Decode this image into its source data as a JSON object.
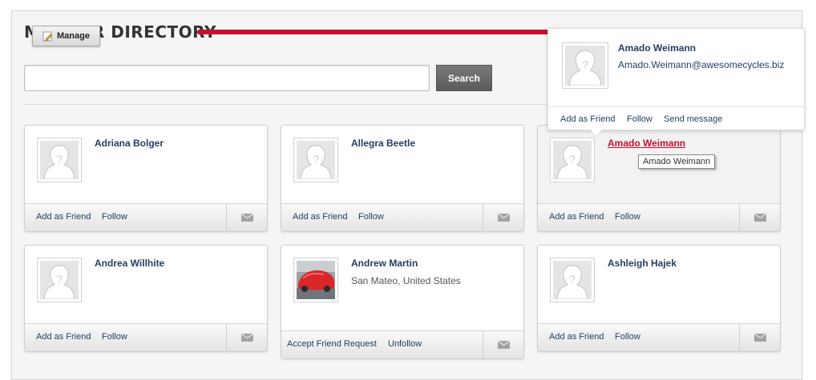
{
  "header": {
    "title": "MEMBER DIRECTORY",
    "manage_label": "Manage"
  },
  "search": {
    "value": "",
    "placeholder": "",
    "button_label": "Search"
  },
  "members": [
    {
      "name": "Adriana Bolger",
      "location": "",
      "actions": [
        "Add as Friend",
        "Follow"
      ]
    },
    {
      "name": "Allegra Beetle",
      "location": "",
      "actions": [
        "Add as Friend",
        "Follow"
      ]
    },
    {
      "name": "Amado Weimann",
      "location": "",
      "actions": [
        "Add as Friend",
        "Follow"
      ]
    },
    {
      "name": "Andrea Willhite",
      "location": "",
      "actions": [
        "Add as Friend",
        "Follow"
      ]
    },
    {
      "name": "Andrew Martin",
      "location": "San Mateo, United States",
      "actions": [
        "Accept Friend Request",
        "Unfollow"
      ]
    },
    {
      "name": "Ashleigh Hajek",
      "location": "",
      "actions": [
        "Add as Friend",
        "Follow"
      ]
    }
  ],
  "tooltip": "Amado Weimann",
  "popup": {
    "name": "Amado Weimann",
    "email": "Amado.Weimann@awesomecycles.biz",
    "actions": [
      "Add as Friend",
      "Follow",
      "Send message"
    ]
  },
  "colors": {
    "accent_red": "#c8102e",
    "link_navy": "#243e63",
    "button_gray": "#6b6b6b"
  },
  "icons": {
    "manage": "pencil-icon",
    "avatar": "default-avatar-icon",
    "message": "mail-icon"
  }
}
